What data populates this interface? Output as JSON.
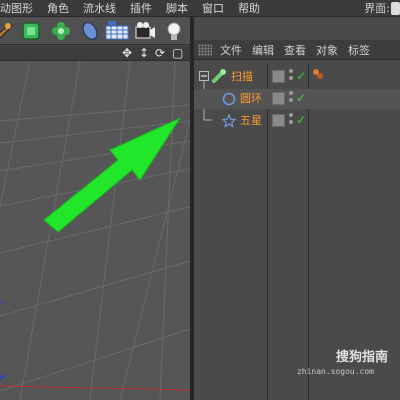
{
  "menubar": {
    "items": [
      "动图形",
      "角色",
      "流水线",
      "插件",
      "脚本",
      "窗口",
      "帮助"
    ],
    "layout_label": "界面:"
  },
  "toolbar": {
    "icons": [
      "cloner-icon",
      "cube-primitive-icon",
      "flower-deformer-icon",
      "leaf-icon",
      "floor-grid-icon",
      "camera-icon",
      "light-icon"
    ]
  },
  "viewport": {
    "controls": [
      "✥",
      "↕",
      "⟳",
      "▢"
    ]
  },
  "object_manager": {
    "menu": [
      "文件",
      "编辑",
      "查看",
      "对象",
      "标签"
    ],
    "objects": [
      {
        "name": "扫描",
        "icon": "sweep-icon",
        "level": 0,
        "checked": true
      },
      {
        "name": "圆环",
        "icon": "circle-spline-icon",
        "level": 1,
        "checked": true
      },
      {
        "name": "五星",
        "icon": "star-spline-icon",
        "level": 1,
        "checked": true
      }
    ]
  },
  "watermark": {
    "text": "搜狗指南",
    "url": "zhinan.sogou.com"
  },
  "colors": {
    "object_name": "#ff9d2b",
    "check": "#38d038",
    "arrow": "#22e62a"
  }
}
